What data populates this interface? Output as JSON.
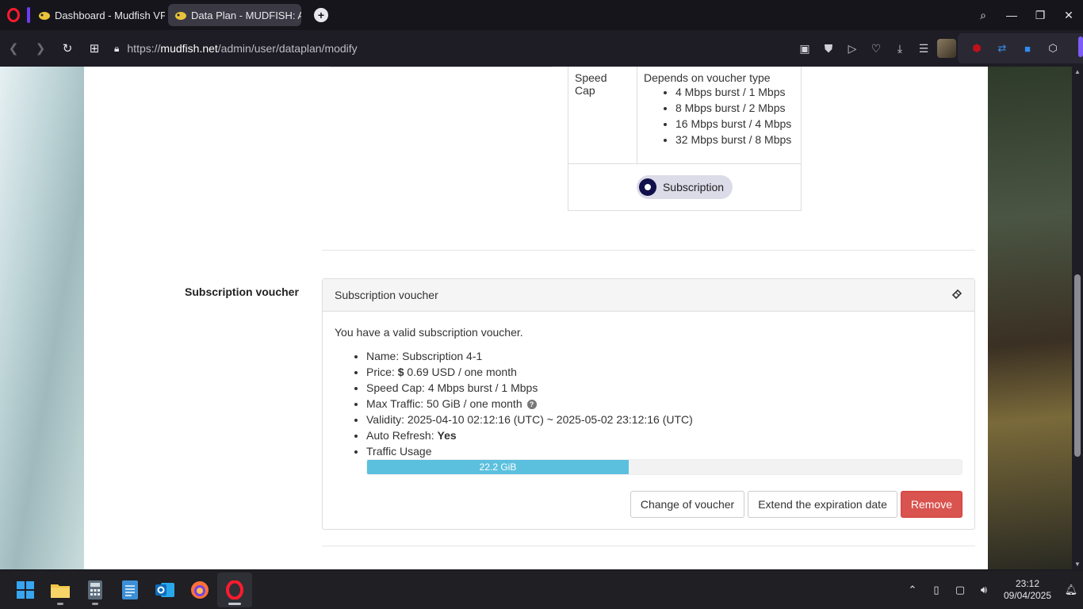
{
  "browser": {
    "tabs": [
      {
        "title": "Dashboard - Mudfish VPN"
      },
      {
        "title": "Data Plan - MUDFISH: Acc"
      }
    ],
    "url_prefix": "https://",
    "url_host": "mudfish.net",
    "url_path": "/admin/user/dataplan/modify"
  },
  "voucher_type_table": {
    "speed_cap_label": "Speed Cap",
    "speed_cap_desc": "Depends on voucher type",
    "speed_options": [
      "4 Mbps burst / 1 Mbps",
      "8 Mbps burst / 2 Mbps",
      "16 Mbps burst / 4 Mbps",
      "32 Mbps burst / 8 Mbps"
    ],
    "subscription_option": "Subscription"
  },
  "subscription_voucher": {
    "field_label": "Subscription voucher",
    "panel_title": "Subscription voucher",
    "intro": "You have a valid subscription voucher.",
    "name": "Name: Subscription 4-1",
    "price_prefix": "Price: ",
    "price_symbol": "$",
    "price_value": " 0.69 USD / one month",
    "speed_cap": "Speed Cap: 4 Mbps burst / 1 Mbps",
    "max_traffic": "Max Traffic: 50 GiB / one month",
    "validity": "Validity: 2025-04-10 02:12:16 (UTC) ~ 2025-05-02 23:12:16 (UTC)",
    "auto_refresh_label": "Auto Refresh: ",
    "auto_refresh_value": "Yes",
    "traffic_usage_label": "Traffic Usage",
    "traffic_usage_value": "22.2 GiB",
    "traffic_usage_fraction": 0.44,
    "buttons": {
      "change": "Change of voucher",
      "extend": "Extend the expiration date",
      "remove": "Remove"
    }
  },
  "taskbar": {
    "time": "23:12",
    "date": "09/04/2025"
  },
  "colors": {
    "progress": "#5bc0de",
    "danger": "#d9534f",
    "radio": "#11104a",
    "opera_red": "#ff1b2d"
  }
}
